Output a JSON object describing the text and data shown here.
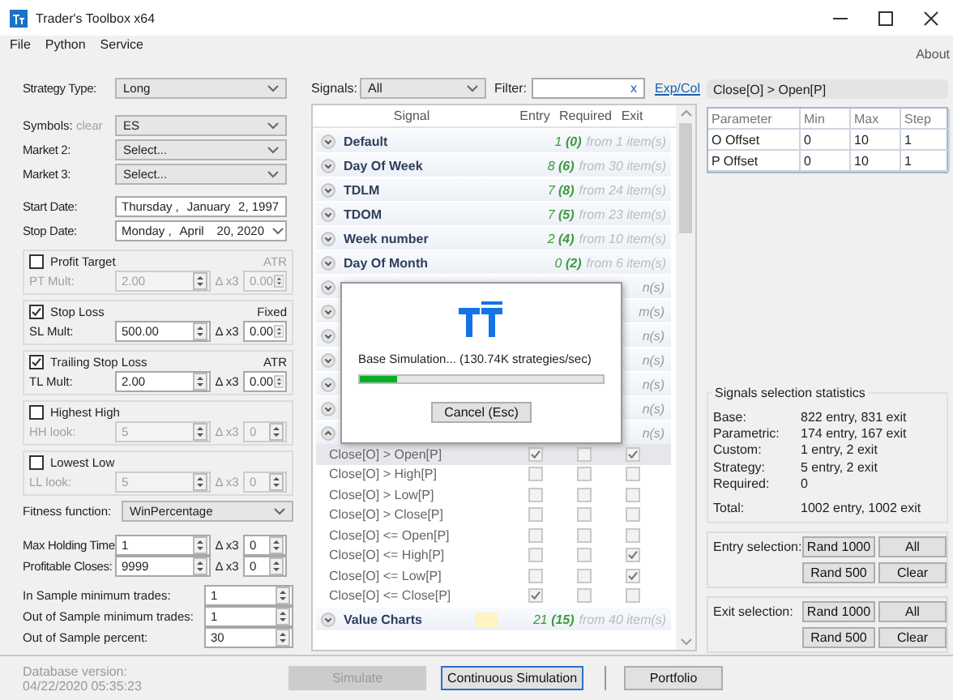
{
  "window": {
    "title": "Trader's Toolbox x64"
  },
  "menu": [
    {
      "label": "File"
    },
    {
      "label": "Python"
    },
    {
      "label": "Service"
    }
  ],
  "about": "About",
  "left": {
    "strategy_type": {
      "label": "Strategy Type:",
      "value": "Long"
    },
    "symbols": {
      "label": "Symbols:",
      "clear": "clear",
      "value": "ES"
    },
    "markets": [
      {
        "label": "Market 2:",
        "value": "Select..."
      },
      {
        "label": "Market 3:",
        "value": "Select..."
      }
    ],
    "dates": [
      {
        "label": "Start Date:",
        "parts": [
          "Thursday",
          ",",
          "January",
          "2, 1997"
        ]
      },
      {
        "label": "Stop Date:",
        "parts": [
          "Monday",
          ",",
          "April",
          "20, 2020"
        ]
      }
    ],
    "exit_groups": [
      {
        "title": "Profit Target",
        "checked": false,
        "unit": "ATR",
        "label": "PT Mult:",
        "value": "2.00",
        "delta_label": "Δ x3",
        "delta": "0.00"
      },
      {
        "title": "Stop Loss",
        "checked": true,
        "unit": "Fixed",
        "label": "SL Mult:",
        "value": "500.00",
        "delta_label": "Δ x3",
        "delta": "0.00"
      },
      {
        "title": "Trailing Stop Loss",
        "checked": true,
        "unit": "ATR",
        "label": "TL Mult:",
        "value": "2.00",
        "delta_label": "Δ x3",
        "delta": "0.00"
      },
      {
        "title": "Highest High",
        "checked": false,
        "label": "HH look:",
        "value": "5",
        "delta_label": "Δ x3",
        "delta": "0"
      },
      {
        "title": "Lowest Low",
        "checked": false,
        "label": "LL look:",
        "value": "5",
        "delta_label": "Δ x3",
        "delta": "0"
      }
    ],
    "fitness": {
      "label": "Fitness function:",
      "value": "WinPercentage"
    },
    "step_rows": [
      {
        "label": "Max Holding Time:",
        "value": "1",
        "delta_label": "Δ x3",
        "delta": "0"
      },
      {
        "label": "Profitable Closes:",
        "value": "9999",
        "delta_label": "Δ x3",
        "delta": "0"
      }
    ],
    "min_rows": [
      {
        "label": "In Sample minimum trades:",
        "value": "1"
      },
      {
        "label": "Out of Sample minimum trades:",
        "value": "1"
      },
      {
        "label": "Out of Sample percent:",
        "value": "30"
      }
    ],
    "database": {
      "label": "Database version:",
      "value": "04/22/2020 05:35:23"
    }
  },
  "signals": {
    "label": "Signals:",
    "value": "All",
    "filter_label": "Filter:",
    "filter_clear": "x",
    "expand_collapse": "Exp/Col",
    "columns": [
      "Signal",
      "Entry",
      "Required",
      "Exit"
    ],
    "groups": [
      {
        "kind": "group",
        "name": "Default",
        "count": "1 **(0)**",
        "total": "from 1 item(s)",
        "expanded": false,
        "flagged": false
      },
      {
        "kind": "group",
        "name": "Day Of Week",
        "count": "8 **(6)**",
        "total": "from 30 item(s)",
        "expanded": false,
        "flagged": false
      },
      {
        "kind": "group",
        "name": "TDLM",
        "count": "7 **(8)**",
        "total": "from 24 item(s)",
        "expanded": false,
        "flagged": false
      },
      {
        "kind": "group",
        "name": "TDOM",
        "count": "7 **(5)**",
        "total": "from 23 item(s)",
        "expanded": false,
        "flagged": false
      },
      {
        "kind": "group",
        "name": "Week number",
        "count": "2 **(4)**",
        "total": "from 10 item(s)",
        "expanded": false,
        "flagged": false
      },
      {
        "kind": "group",
        "name": "Day Of Month",
        "count": "0 **(2)**",
        "total": "from 6 item(s)",
        "expanded": false,
        "flagged": false
      },
      {
        "kind": "covered",
        "tail": "n(s)",
        "expanded": false
      },
      {
        "kind": "covered",
        "tail": "m(s)",
        "expanded": false
      },
      {
        "kind": "covered",
        "tail": "n(s)",
        "expanded": false
      },
      {
        "kind": "covered",
        "tail": "n(s)",
        "expanded": false
      },
      {
        "kind": "covered",
        "tail": "n(s)",
        "expanded": false
      },
      {
        "kind": "covered",
        "tail": "n(s)",
        "expanded": false
      },
      {
        "kind": "covered",
        "tail": "n(s)",
        "expanded": true,
        "children": [
          {
            "name": "Close[O] > Open[P]",
            "entry": true,
            "required": false,
            "exit": true,
            "selected": true
          },
          {
            "name": "Close[O] > High[P]",
            "entry": false,
            "required": false,
            "exit": false,
            "selected": false
          },
          {
            "name": "Close[O] > Low[P]",
            "entry": false,
            "required": false,
            "exit": false,
            "selected": false
          },
          {
            "name": "Close[O] > Close[P]",
            "entry": false,
            "required": false,
            "exit": false,
            "selected": false
          },
          {
            "name": "Close[O] <= Open[P]",
            "entry": false,
            "required": false,
            "exit": false,
            "selected": false
          },
          {
            "name": "Close[O] <= High[P]",
            "entry": false,
            "required": false,
            "exit": true,
            "selected": false
          },
          {
            "name": "Close[O] <= Low[P]",
            "entry": false,
            "required": false,
            "exit": true,
            "selected": false
          },
          {
            "name": "Close[O] <= Close[P]",
            "entry": true,
            "required": false,
            "exit": false,
            "selected": false
          }
        ]
      },
      {
        "kind": "group",
        "name": "Value Charts",
        "count": "21 **(15)**",
        "total": "from 40 item(s)",
        "expanded": false,
        "flagged": true
      }
    ]
  },
  "dialog": {
    "message": "Base Simulation... (130.74K strategies/sec)",
    "level": 0.15,
    "button": "Cancel (Esc)"
  },
  "parameters": {
    "title": "Close[O] > Open[P]",
    "columns": [
      "Parameter",
      "Min",
      "Max",
      "Step"
    ],
    "rows": [
      [
        "O Offset",
        "0",
        "10",
        "1"
      ],
      [
        "P Offset",
        "0",
        "10",
        "1"
      ]
    ]
  },
  "stats": {
    "title": "Signals selection statistics",
    "rows": [
      {
        "label": "Base:",
        "value": "822 entry, 831 exit"
      },
      {
        "label": "Parametric:",
        "value": "174 entry, 167 exit"
      },
      {
        "label": "Custom:",
        "value": "1 entry, 2 exit"
      },
      {
        "label": "Strategy:",
        "value": "5 entry, 2 exit"
      },
      {
        "label": "Required:",
        "value": "0"
      },
      {
        "label": "Total:",
        "value": "1002 entry, 1002 exit"
      }
    ]
  },
  "selections": [
    {
      "label": "Entry selection:",
      "buttons": [
        "Rand 1000",
        "All",
        "Rand 500",
        "Clear"
      ]
    },
    {
      "label": "Exit selection:",
      "buttons": [
        "Rand 1000",
        "All",
        "Rand 500",
        "Clear"
      ]
    }
  ],
  "bottom_buttons": [
    {
      "label": "Simulate",
      "disabled": true,
      "focused": false
    },
    {
      "label": "Continuous Simulation",
      "disabled": false,
      "focused": true
    },
    {
      "label": "Portfolio",
      "disabled": false,
      "focused": false
    }
  ]
}
